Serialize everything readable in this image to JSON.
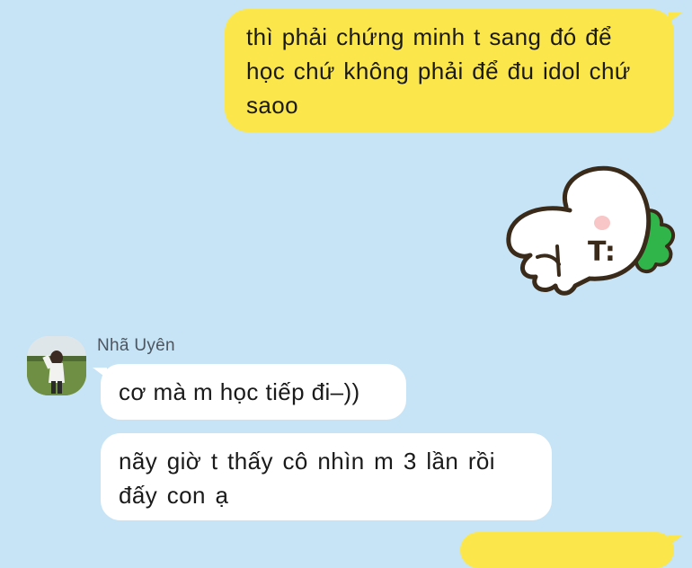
{
  "conversation": {
    "outgoing_1": "thì phải chứng minh t sang đó để học chứ không phải để đu idol chứ saoo",
    "sticker_text": "T:",
    "contact_name": "Nhã Uyên",
    "incoming_1": "cơ mà m học tiếp đi–))",
    "incoming_2": "nãy giờ t thấy cô nhìn m 3 lần rồi đấy con ạ"
  },
  "colors": {
    "background": "#c6e4f5",
    "outgoing_bubble": "#fbe64b",
    "incoming_bubble": "#ffffff"
  },
  "icons": {
    "sticker": "sleeping-rabbit-sticker",
    "avatar": "contact-avatar-photo"
  }
}
